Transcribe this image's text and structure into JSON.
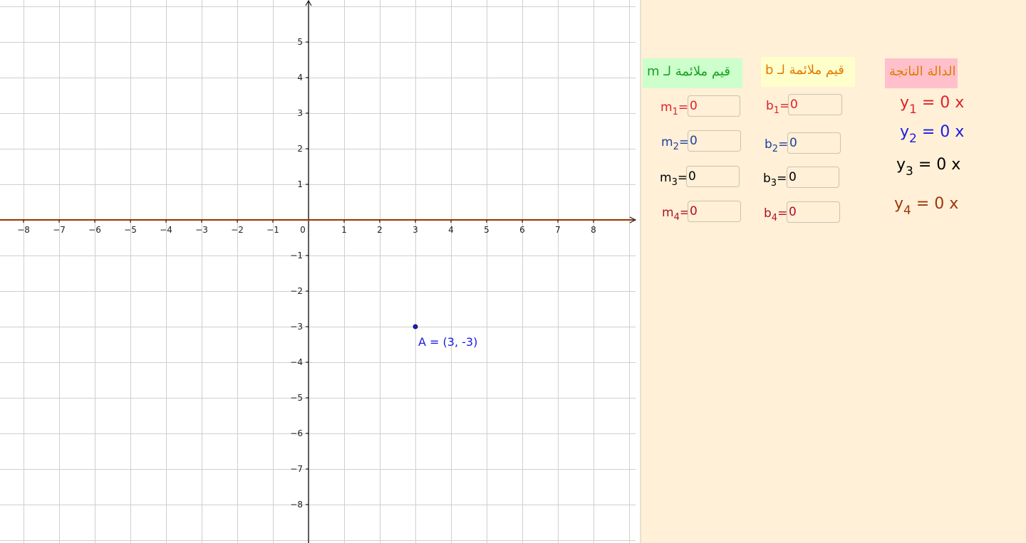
{
  "graph": {
    "x_ticks": [
      "−8",
      "−7",
      "−6",
      "−5",
      "−4",
      "−3",
      "−2",
      "−1",
      "0",
      "1",
      "2",
      "3",
      "4",
      "5",
      "6",
      "7",
      "8"
    ],
    "y_ticks_positive": [
      "5",
      "4",
      "3",
      "2",
      "1"
    ],
    "y_ticks_negative": [
      "−1",
      "−2",
      "−3",
      "−4",
      "−5",
      "−6",
      "−7",
      "−8"
    ],
    "axis_color": "#993300",
    "grid_color": "#cfcfcf",
    "point": {
      "label": "A = (3, -3)",
      "x": 3,
      "y": -3,
      "color": "#1a1ae6"
    }
  },
  "panel": {
    "background": "#fff0d7",
    "headers": {
      "m": {
        "text": "قيم ملائمة لـ m",
        "color": "#16a01f",
        "bg": "#ccffcc"
      },
      "b": {
        "text": "قيم ملائمة لـ b",
        "color": "#e07a00",
        "bg": "#ffffcc"
      },
      "result": {
        "text": "الدالة الناتجة",
        "color": "#e07a00",
        "bg": "#ffc0cb"
      }
    },
    "m_inputs": [
      {
        "var": "m",
        "sub": "1",
        "eq": "=",
        "value": "0",
        "color": "#e0202a"
      },
      {
        "var": "m",
        "sub": "2",
        "eq": "=",
        "value": "0",
        "color": "#1f3fa0"
      },
      {
        "var": "m",
        "sub": "3",
        "eq": "=",
        "value": "0",
        "color": "#000000"
      },
      {
        "var": "m",
        "sub": "4",
        "eq": "=",
        "value": "0",
        "color": "#b0102a"
      }
    ],
    "b_inputs": [
      {
        "var": "b",
        "sub": "1",
        "eq": "=",
        "value": "0",
        "color": "#e0202a"
      },
      {
        "var": "b",
        "sub": "2",
        "eq": "=",
        "value": "0",
        "color": "#1f3fa0"
      },
      {
        "var": "b",
        "sub": "3",
        "eq": "=",
        "value": "0",
        "color": "#000000"
      },
      {
        "var": "b",
        "sub": "4",
        "eq": "=",
        "value": "0",
        "color": "#b0102a"
      }
    ],
    "results": [
      {
        "var": "y",
        "sub": "1",
        "expr": " = 0 x",
        "color": "#e0202a"
      },
      {
        "var": "y",
        "sub": "2",
        "expr": " = 0 x",
        "color": "#1a1ae6"
      },
      {
        "var": "y",
        "sub": "3",
        "expr": " = 0 x",
        "color": "#000000"
      },
      {
        "var": "y",
        "sub": "4",
        "expr": " = 0 x",
        "color": "#a0360a"
      }
    ]
  }
}
